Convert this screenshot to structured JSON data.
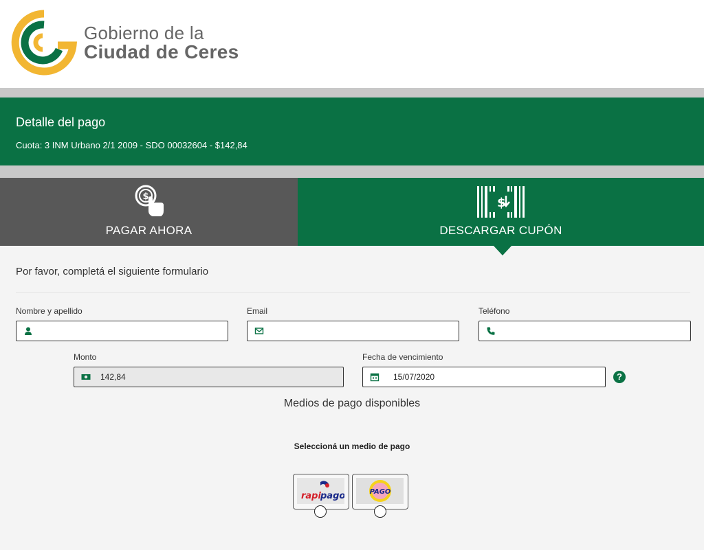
{
  "header": {
    "logo_line1": "Gobierno de la",
    "logo_line2": "Ciudad de Ceres",
    "logo_icon": "ceres-logo-icon"
  },
  "detail": {
    "title": "Detalle del pago",
    "subtitle": "Cuota: 3 INM Urbano 2/1 2009 - SDO 00032604 - $142,84"
  },
  "tabs": [
    {
      "label": "PAGAR AHORA",
      "icon": "touch-pay-icon",
      "active": false
    },
    {
      "label": "DESCARGAR CUPÓN",
      "icon": "barcode-download-icon",
      "active": true
    }
  ],
  "form": {
    "intro": "Por favor, completá el siguiente formulario",
    "name_label": "Nombre y apellido",
    "name_value": "",
    "email_label": "Email",
    "email_value": "",
    "phone_label": "Teléfono",
    "phone_value": "",
    "amount_label": "Monto",
    "amount_value": "142,84",
    "due_label": "Fecha de vencimiento",
    "due_value": "15/07/2020"
  },
  "payment": {
    "title": "Medios de pago disponibles",
    "subtitle": "Seleccioná un medio de pago",
    "options": [
      {
        "name": "rapipago",
        "icon": "rapipago-logo"
      },
      {
        "name": "Pago Fácil",
        "icon": "pagofacil-logo"
      }
    ]
  },
  "colors": {
    "brand_green": "#0a7144",
    "logo_yellow": "#f2b632",
    "tab_gray": "#585858",
    "band_gray": "#c8c8c8"
  }
}
